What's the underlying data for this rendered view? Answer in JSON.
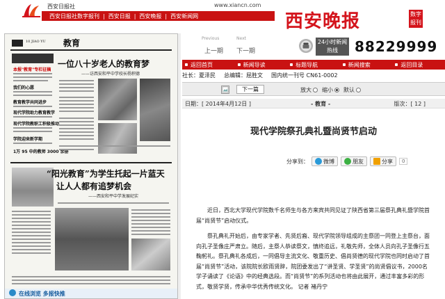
{
  "header": {
    "site_name": "西安日报社",
    "url": "www.xiancn.com",
    "nav": [
      "西安日报社数字报刊",
      "西安日报",
      "西安晚报",
      "西安新闻网"
    ],
    "brand_title": "西安晚报",
    "brand_badge": "数字报刊"
  },
  "thumbnail": {
    "page_no": "10 JIAO YU",
    "section": "教育",
    "headline1": "一位八十岁老人的教育梦",
    "subhead1": "——访西安和平中学校长杨积德",
    "headline2": "“阳光教育”为学生托起一片蓝天",
    "headline3": "让人人都有追梦机会",
    "subhead3": "——西安和平中学发展纪实",
    "left_blurbs": [
      "本报\"教育\"专栏征稿",
      "我们的心愿",
      "教育教学共同进步",
      "现代学院助力教育教学",
      "现代学院教职工积极推动",
      "学院迎来新学期",
      "1万 95 中的教师 3000 余册"
    ],
    "bottom_ad": "在线浏览 多报快推"
  },
  "prev_next": {
    "prev_small": "Previous",
    "next_small": "Next",
    "prev": "上一期",
    "next": "下一期"
  },
  "hotline": {
    "box": "24小时新闻热线",
    "number": "88229999"
  },
  "sub_nav": [
    "返回首页",
    "新闻导读",
    "标题导航",
    "新闻搜索",
    "返回目录"
  ],
  "meta": {
    "publisher": "社长：夏泽民",
    "editor": "总编辑：屈胜文",
    "issn": "国内统一刊号 CN61-0002"
  },
  "toolbar": {
    "next_article": "下一篇",
    "font_large": "放大",
    "font_small": "缩小",
    "font_default": "默认"
  },
  "date_bar": {
    "date": "日期：[ 2014年4月12日 ]",
    "section": "- 教育 -",
    "edition": "版次：[ 12 ]"
  },
  "article": {
    "title": "现代学院祭孔典礼暨尚贤节启动",
    "paragraphs": [
      "近日，西北大学现代学院数千名师生与各方来宾共同见证了陕西省第三届祭孔典礼暨学院首届“尚贤节”启动仪式。",
      "祭孔典礼开始后，由专家学者、先贤后裔、现代学院领导组成的主祭团一同登上主祭台，面向孔子圣像庄严肃立。随后，主祭人恭读祭文，慎终追远，礼敬先师，全体人员向孔子圣像行五鞠躬礼。祭孔典礼各成后，一同倡导主流文化、敬重历史、倡尚贤德的现代学院也同时启动了首届“尚贤节”活动，该院院长欧雨贤辞，院团委发出了“讲圣贤、学圣贤”的尚贤倡议书，2000名学子诵读了《论语》中的经典选段。而“尚贤节”的系列活动也将由此展开，通过丰富多彩的形式，敬贤学贤，传承中华优秀传统文化。 记者 褚丹宁"
    ]
  },
  "share": {
    "label": "分享到：",
    "buttons": [
      "微博",
      "朋友",
      "分享"
    ],
    "count": "0"
  },
  "colors": {
    "brand_red": "#d4141c",
    "nav_red": "#c91212"
  }
}
